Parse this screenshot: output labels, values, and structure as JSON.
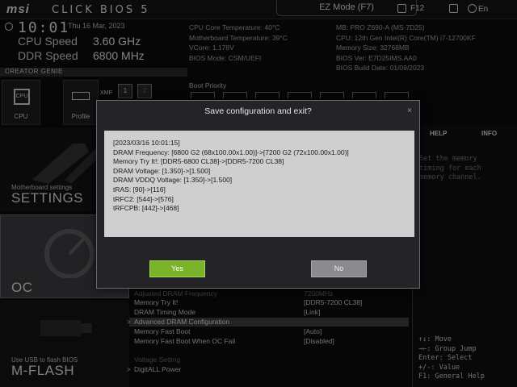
{
  "topbar": {
    "brand": "msi",
    "product": "CLICK BIOS 5",
    "ez_mode": "EZ Mode (F7)",
    "f12": "F12",
    "language": "En"
  },
  "header": {
    "time": "10:01",
    "date": "Thu 16 Mar, 2023",
    "cpu_speed_label": "CPU Speed",
    "cpu_speed_value": "3.60 GHz",
    "ddr_speed_label": "DDR Speed",
    "ddr_speed_value": "6800 MHz",
    "info_left": [
      "CPU Core Temperature: 40°C",
      "Motherboard Temperature: 39°C",
      "VCore: 1.178V",
      "BIOS Mode: CSM/UEFI"
    ],
    "info_right": [
      "MB: PRO Z690-A (MS-7D25)",
      "CPU: 12th Gen Intel(R) Core(TM) i7-12700KF",
      "Memory Size: 32768MB",
      "BIOS Ver: E7D25IMS.AA0",
      "BIOS Build Date: 01/09/2023"
    ],
    "creator_genie": "CREATOR GENIE",
    "tile_cpu": "CPU",
    "tile_cpu_chip": "CPU",
    "tile_profile": "Profile",
    "xmp": "XMP",
    "xmp_1": "1",
    "xmp_2": "2",
    "boot_priority": "Boot Priority"
  },
  "nav": {
    "settings_sub": "Motherboard settings",
    "settings_main": "SETTINGS",
    "oc_main": "OC",
    "mflash_sub": "Use USB to flash BIOS",
    "mflash_main": "M-FLASH"
  },
  "list": {
    "rows": [
      {
        "key": "Adjusted DRAM Frequency",
        "value": "7200MHz"
      },
      {
        "key": "Memory Try It!",
        "value": "[DDR5-7200 CL38]"
      },
      {
        "key": "DRAM Timing Mode",
        "value": "[Link]"
      },
      {
        "key": "Advanced DRAM Configuration",
        "value": ""
      },
      {
        "key": "Memory Fast Boot",
        "value": "[Auto]"
      },
      {
        "key": "Memory Fast Boot When OC Fail",
        "value": "[Disabled]"
      },
      {
        "key": "Voltage Setting",
        "value": ""
      },
      {
        "key": "DigitALL Power",
        "value": ""
      }
    ]
  },
  "help": {
    "tab_help": "HELP",
    "tab_info": "INFO",
    "text": "Set the memory timing for each memory channel.",
    "keys": [
      "↑↓: Move",
      "→←: Group Jump",
      "Enter: Select",
      "+/-: Value",
      "F1: General Help"
    ]
  },
  "modal": {
    "title": "Save configuration and exit?",
    "close": "×",
    "lines": [
      "[2023/03/16 10:01:15]",
      "DRAM Frequency: [6800 G2 (68x100.00x1.00)]->[7200 G2 (72x100.00x1.00)]",
      "Memory Try It!: [DDR5-6800 CL38]->[DDR5-7200 CL38]",
      "DRAM Voltage: [1.350]->[1.500]",
      "DRAM VDDQ Voltage: [1.350]->[1.500]",
      "tRAS: [90]->[116]",
      "tRFC2: [544]->[576]",
      "tRFCPB: [442]->[468]"
    ],
    "yes": "Yes",
    "no": "No"
  }
}
